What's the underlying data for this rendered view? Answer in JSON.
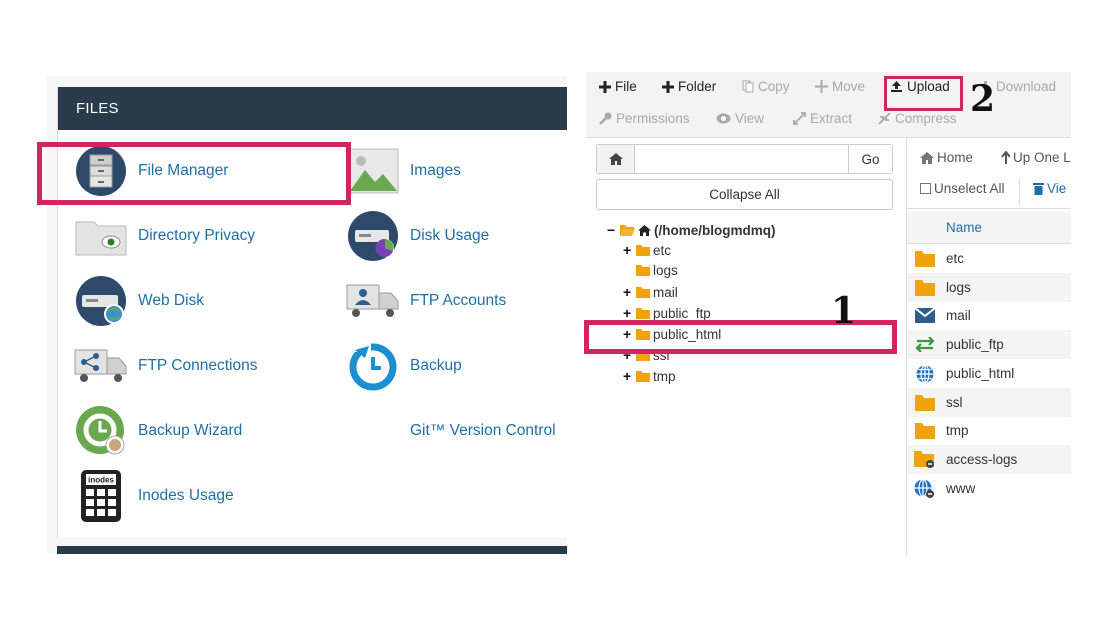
{
  "files_panel": {
    "header": "FILES",
    "apps": [
      {
        "label": "File Manager",
        "icon": "file-cabinet-icon"
      },
      {
        "label": "Images",
        "icon": "image-icon"
      },
      {
        "label": "Directory Privacy",
        "icon": "folder-eye-icon"
      },
      {
        "label": "Disk Usage",
        "icon": "disk-usage-icon"
      },
      {
        "label": "Web Disk",
        "icon": "web-disk-icon"
      },
      {
        "label": "FTP Accounts",
        "icon": "ftp-accounts-icon"
      },
      {
        "label": "FTP Connections",
        "icon": "ftp-connections-icon"
      },
      {
        "label": "Backup",
        "icon": "backup-icon"
      },
      {
        "label": "Backup Wizard",
        "icon": "backup-wizard-icon"
      },
      {
        "label": "Git™ Version Control",
        "icon": ""
      },
      {
        "label": "Inodes Usage",
        "icon": "inodes-calculator-icon"
      }
    ],
    "inodes_icon_text": "inodes"
  },
  "toolbar": {
    "file": "File",
    "folder": "Folder",
    "copy": "Copy",
    "move": "Move",
    "upload": "Upload",
    "download": "Download",
    "permissions": "Permissions",
    "view": "View",
    "extract": "Extract",
    "compress": "Compress"
  },
  "search": {
    "placeholder": "",
    "go": "Go"
  },
  "collapse_all": "Collapse All",
  "tree": {
    "root": "(/home/blogmdmq)",
    "items": [
      "etc",
      "logs",
      "mail",
      "public_ftp",
      "public_html",
      "ssl",
      "tmp"
    ]
  },
  "nav": {
    "home": "Home",
    "up_one": "Up One L",
    "unselect_all": "Unselect All",
    "view": "Vie"
  },
  "file_list": {
    "column_name": "Name",
    "rows": [
      "etc",
      "logs",
      "mail",
      "public_ftp",
      "public_html",
      "ssl",
      "tmp",
      "access-logs",
      "www"
    ]
  },
  "annotations": {
    "step1": "1",
    "step2": "2"
  },
  "colors": {
    "highlight": "#d2245f",
    "header_bg": "#293a4a",
    "link_blue": "#1f6fa7",
    "folder": "#f0a30a"
  }
}
